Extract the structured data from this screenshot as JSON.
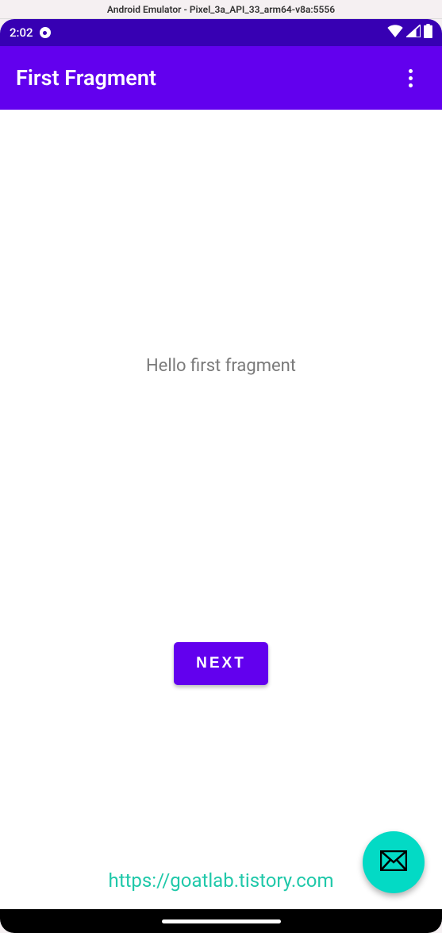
{
  "emulator": {
    "title": "Android Emulator - Pixel_3a_API_33_arm64-v8a:5556"
  },
  "status_bar": {
    "time": "2:02"
  },
  "app_bar": {
    "title": "First Fragment"
  },
  "content": {
    "hello_label": "Hello first fragment",
    "next_button_label": "NEXT"
  },
  "watermark": {
    "url_text": "https://goatlab.tistory.com"
  },
  "colors": {
    "primary": "#6200EE",
    "primary_dark": "#3700B3",
    "fab": "#03DAC5"
  }
}
